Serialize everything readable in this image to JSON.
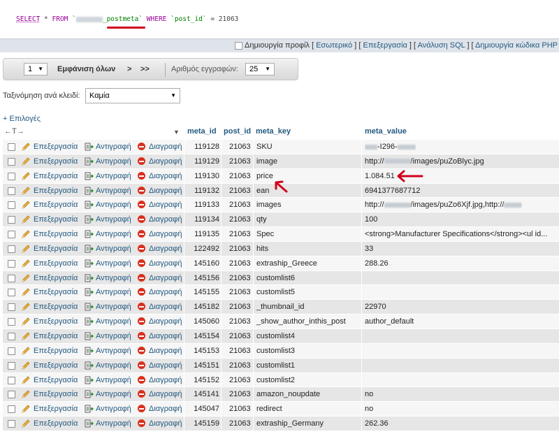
{
  "sql": {
    "select": "SELECT",
    "star": " * ",
    "from": "FROM",
    "table_suffix": "_postmeta`",
    "where": "WHERE",
    "column": "`post_id`",
    "op": " = ",
    "value": "21063"
  },
  "toollinks": {
    "create_profile": "Δημιουργία προφίλ",
    "inline": "Εσωτερικό",
    "edit": "Επεξεργασία",
    "explain": "Ανάλυση SQL",
    "create_php": "Δημιουργία κώδικα PHP"
  },
  "nav": {
    "page": "1",
    "show_all": "Εμφάνιση όλων",
    "next": ">",
    "last": ">>",
    "rows_label": "Αριθμός εγγραφών:",
    "rows_value": "25"
  },
  "sort": {
    "label": "Ταξινόμηση ανά κλειδί:",
    "value": "Καμία"
  },
  "options_label": "+ Επιλογές",
  "arrows": "←T→",
  "columns": [
    "meta_id",
    "post_id",
    "meta_key",
    "meta_value"
  ],
  "actions": {
    "edit": "Επεξεργασία",
    "copy": "Αντιγραφή",
    "delete": "Διαγραφή"
  },
  "rows": [
    {
      "meta_id": "119128",
      "post_id": "21063",
      "meta_key": "SKU",
      "meta_value": "-I296-"
    },
    {
      "meta_id": "119129",
      "post_id": "21063",
      "meta_key": "image",
      "meta_value": "/images/puZoBlyc.jpg"
    },
    {
      "meta_id": "119130",
      "post_id": "21063",
      "meta_key": "price",
      "meta_value": "1.084.51"
    },
    {
      "meta_id": "119132",
      "post_id": "21063",
      "meta_key": "ean",
      "meta_value": "6941377687712"
    },
    {
      "meta_id": "119133",
      "post_id": "21063",
      "meta_key": "images",
      "meta_value": "/images/puZo6Xjf.jpg,http://"
    },
    {
      "meta_id": "119134",
      "post_id": "21063",
      "meta_key": "qty",
      "meta_value": "100"
    },
    {
      "meta_id": "119135",
      "post_id": "21063",
      "meta_key": "Spec",
      "meta_value": "<strong>Manufacturer Specifications</strong><ul id..."
    },
    {
      "meta_id": "122492",
      "post_id": "21063",
      "meta_key": "hits",
      "meta_value": "33"
    },
    {
      "meta_id": "145160",
      "post_id": "21063",
      "meta_key": "extraship_Greece",
      "meta_value": "288.26"
    },
    {
      "meta_id": "145156",
      "post_id": "21063",
      "meta_key": "customlist6",
      "meta_value": ""
    },
    {
      "meta_id": "145155",
      "post_id": "21063",
      "meta_key": "customlist5",
      "meta_value": ""
    },
    {
      "meta_id": "145182",
      "post_id": "21063",
      "meta_key": "_thumbnail_id",
      "meta_value": "22970"
    },
    {
      "meta_id": "145060",
      "post_id": "21063",
      "meta_key": "_show_author_inthis_post",
      "meta_value": "author_default"
    },
    {
      "meta_id": "145154",
      "post_id": "21063",
      "meta_key": "customlist4",
      "meta_value": ""
    },
    {
      "meta_id": "145153",
      "post_id": "21063",
      "meta_key": "customlist3",
      "meta_value": ""
    },
    {
      "meta_id": "145151",
      "post_id": "21063",
      "meta_key": "customlist1",
      "meta_value": ""
    },
    {
      "meta_id": "145152",
      "post_id": "21063",
      "meta_key": "customlist2",
      "meta_value": ""
    },
    {
      "meta_id": "145141",
      "post_id": "21063",
      "meta_key": "amazon_noupdate",
      "meta_value": "no"
    },
    {
      "meta_id": "145047",
      "post_id": "21063",
      "meta_key": "redirect",
      "meta_value": "no"
    },
    {
      "meta_id": "145159",
      "post_id": "21063",
      "meta_key": "extraship_Germany",
      "meta_value": "262.36"
    }
  ],
  "colors": {
    "link": "#235a81",
    "annotation_red": "#d0021b",
    "keyword": "#990099",
    "string": "#008000",
    "delete_icon": "#d9301e"
  }
}
